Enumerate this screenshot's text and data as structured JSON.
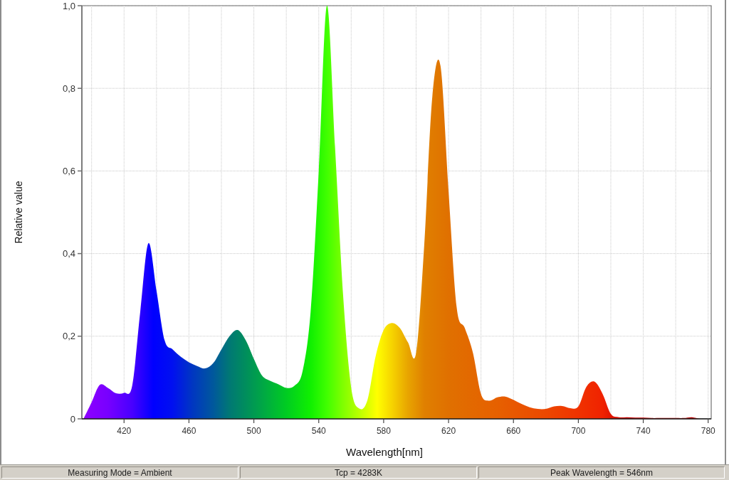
{
  "chart": {
    "chart_data": {
      "type": "area",
      "xlabel": "Wavelength[nm]",
      "ylabel": "Relative value",
      "grid": true,
      "x": [
        395,
        400,
        405,
        410,
        415,
        420,
        425,
        430,
        435,
        440,
        445,
        450,
        455,
        460,
        465,
        470,
        475,
        480,
        485,
        490,
        495,
        500,
        505,
        510,
        515,
        520,
        525,
        530,
        535,
        540,
        545,
        550,
        555,
        560,
        565,
        570,
        575,
        580,
        585,
        590,
        595,
        600,
        605,
        610,
        615,
        620,
        625,
        630,
        635,
        640,
        645,
        650,
        655,
        660,
        665,
        670,
        675,
        680,
        685,
        690,
        695,
        700,
        705,
        710,
        715,
        720,
        725,
        730,
        735,
        740,
        745,
        750,
        755,
        760,
        765,
        770,
        775,
        780
      ],
      "values": [
        0.0,
        0.04,
        0.082,
        0.075,
        0.062,
        0.063,
        0.08,
        0.26,
        0.425,
        0.31,
        0.19,
        0.168,
        0.15,
        0.137,
        0.128,
        0.122,
        0.135,
        0.168,
        0.2,
        0.215,
        0.19,
        0.145,
        0.105,
        0.092,
        0.084,
        0.075,
        0.08,
        0.115,
        0.26,
        0.6,
        1.0,
        0.66,
        0.3,
        0.075,
        0.025,
        0.045,
        0.15,
        0.215,
        0.232,
        0.22,
        0.185,
        0.16,
        0.42,
        0.78,
        0.855,
        0.55,
        0.27,
        0.22,
        0.16,
        0.06,
        0.044,
        0.052,
        0.054,
        0.046,
        0.036,
        0.028,
        0.024,
        0.024,
        0.03,
        0.031,
        0.026,
        0.03,
        0.078,
        0.09,
        0.06,
        0.012,
        0.004,
        0.004,
        0.003,
        0.003,
        0.002,
        0.002,
        0.002,
        0.002,
        0.002,
        0.004,
        0.0,
        0.0
      ],
      "xlim": [
        394,
        781
      ],
      "ylim": [
        0,
        1
      ],
      "xticks": [
        420,
        460,
        500,
        540,
        580,
        620,
        660,
        700,
        740,
        780
      ],
      "yticks": [
        {
          "value": 0,
          "label": "0"
        },
        {
          "value": 0.2,
          "label": "0,2"
        },
        {
          "value": 0.4,
          "label": "0,4"
        },
        {
          "value": 0.6,
          "label": "0,6"
        },
        {
          "value": 0.8,
          "label": "0,8"
        },
        {
          "value": 1,
          "label": "1,0"
        }
      ]
    }
  },
  "status_bar": [
    "Measuring Mode = Ambient",
    "Tcp = 4283K",
    "Peak Wavelength = 546nm"
  ]
}
